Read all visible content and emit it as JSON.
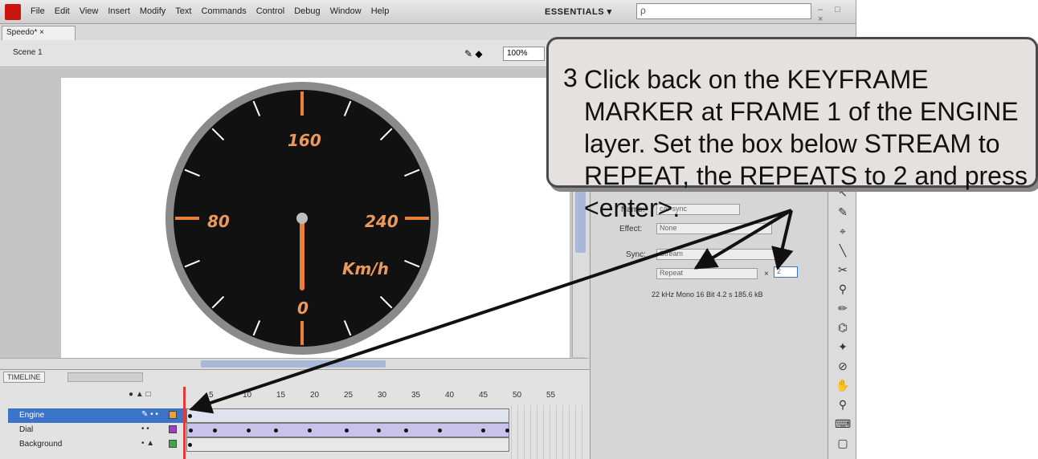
{
  "app": {
    "menu": [
      "File",
      "Edit",
      "View",
      "Insert",
      "Modify",
      "Text",
      "Commands",
      "Control",
      "Debug",
      "Window",
      "Help"
    ],
    "workspace_label": "ESSENTIALS ▾",
    "search_icon_glyph": "ρ",
    "window_controls": "– □ ×"
  },
  "document": {
    "tab_label": "Speedo* ×",
    "scene_label": "Scene 1",
    "zoom": "100%"
  },
  "gauge": {
    "labels": {
      "top": "160",
      "left": "80",
      "right": "240",
      "bottom": "0",
      "unit": "Km/h"
    },
    "colors": {
      "face": "#111111",
      "rim": "#7a7a7a",
      "accent": "#e8803a",
      "label": "#ec9a5a"
    }
  },
  "timeline": {
    "tab_label": "TIMELINE",
    "header_icons": "● ▲ □",
    "frame_numbers": [
      "5",
      "10",
      "15",
      "20",
      "25",
      "30",
      "35",
      "40",
      "45",
      "50",
      "55"
    ],
    "layers": [
      {
        "name": "Engine",
        "color": "#e9a13b",
        "selected": true
      },
      {
        "name": "Dial",
        "color": "#9b3fc9",
        "selected": false
      },
      {
        "name": "Background",
        "color": "#3aa84a",
        "selected": false
      }
    ]
  },
  "properties": {
    "name_label": "Name:",
    "name_value": "car-sync",
    "effect_label": "Effect:",
    "effect_value": "None",
    "sync_label": "Sync:",
    "sync_value": "Stream",
    "repeat_value": "Repeat",
    "repeat_count": "2",
    "sound_info": "22 kHz Mono 16 Bit 4.2 s 185.6 kB"
  },
  "callout": {
    "step": "3",
    "text": "Click back on the KEYFRAME MARKER at FRAME 1 of the ENGINE layer.  Set the box below STREAM to REPEAT, the REPEATS to 2 and press <enter>."
  }
}
